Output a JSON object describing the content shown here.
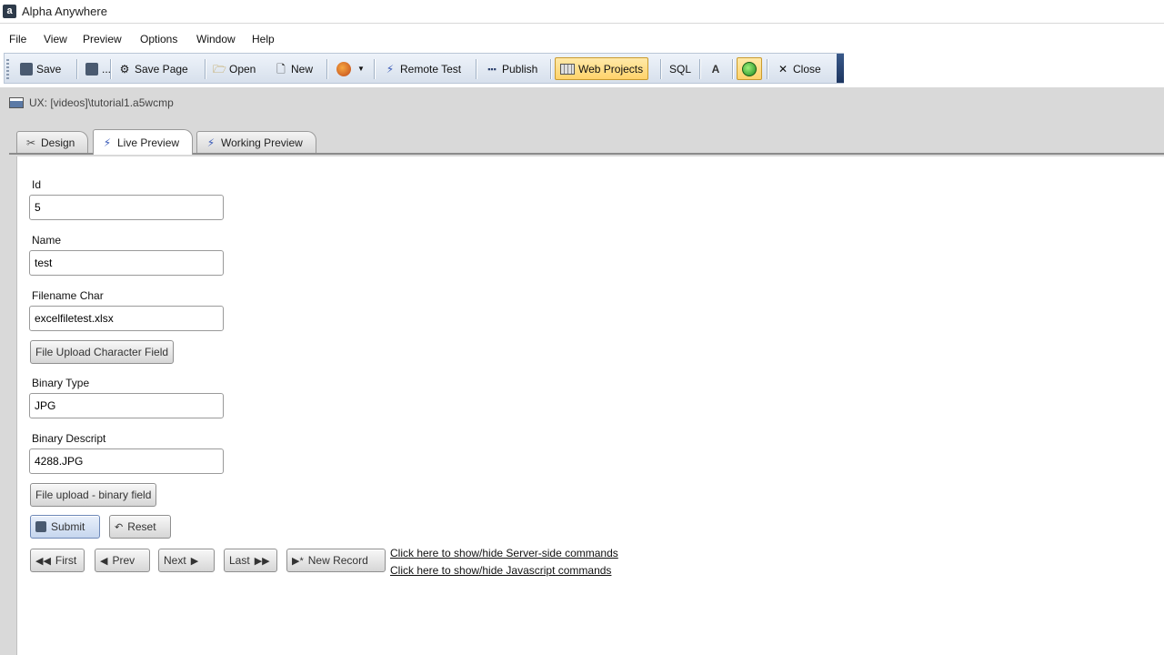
{
  "window": {
    "title": "Alpha Anywhere"
  },
  "menu": [
    "File",
    "View",
    "Preview",
    "Options",
    "Window",
    "Help"
  ],
  "toolbar": {
    "save": "Save",
    "more": "...",
    "save_page": "Save Page",
    "open": "Open",
    "new": "New",
    "remote_test": "Remote Test",
    "publish": "Publish",
    "web_projects": "Web Projects",
    "sql": "SQL",
    "close": "Close"
  },
  "document": {
    "title": "UX: [videos]\\tutorial1.a5wcmp"
  },
  "tabs": [
    "Design",
    "Live Preview",
    "Working Preview"
  ],
  "active_tab": "Live Preview",
  "form": {
    "fields": [
      {
        "label": "Id",
        "value": "5"
      },
      {
        "label": "Name",
        "value": "test"
      },
      {
        "label": "Filename Char",
        "value": "excelfiletest.xlsx"
      },
      {
        "label": "Binary Type",
        "value": "JPG"
      },
      {
        "label": "Binary Descript",
        "value": "4288.JPG"
      }
    ],
    "upload_char_button": "File Upload Character Field",
    "upload_binary_button": "File upload - binary field",
    "submit": "Submit",
    "reset": "Reset"
  },
  "navigation": {
    "first": "First",
    "prev": "Prev",
    "next": "Next",
    "last": "Last",
    "new_record": "New Record"
  },
  "links": {
    "server_side": "Click here to show/hide Server-side commands",
    "javascript": "Click here to show/hide Javascript commands"
  }
}
